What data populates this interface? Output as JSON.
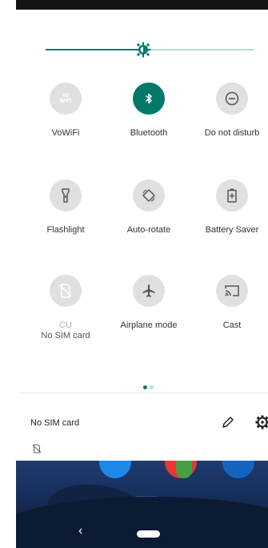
{
  "quick_settings": {
    "brightness_level": 0.47,
    "tiles": [
      {
        "label": "VoWiFi",
        "icon": "vowifi-icon",
        "glyph": "Vo\nWiFi",
        "active": false
      },
      {
        "label": "Bluetooth",
        "icon": "bluetooth-icon",
        "active": true
      },
      {
        "label": "Do not disturb",
        "icon": "do-not-disturb-icon",
        "active": false
      },
      {
        "label": "Flashlight",
        "icon": "flashlight-icon",
        "active": false
      },
      {
        "label": "Auto-rotate",
        "icon": "auto-rotate-icon",
        "active": false
      },
      {
        "label": "Battery Saver",
        "icon": "battery-saver-icon",
        "active": false
      },
      {
        "label": "CU",
        "sublabel": "No SIM card",
        "icon": "no-sim-icon",
        "active": false,
        "disabled": true
      },
      {
        "label": "Airplane mode",
        "icon": "airplane-icon",
        "active": false
      },
      {
        "label": "Cast",
        "icon": "cast-icon",
        "active": false
      }
    ],
    "page_indicator": {
      "pages": 2,
      "current": 1
    },
    "footer": {
      "carrier_text": "No SIM card"
    }
  },
  "colors": {
    "accent": "#00796b",
    "accent_light": "#b2dfdb",
    "tile_inactive": "#e0e0e0"
  },
  "navigation": {
    "back_icon": "back-chevron-icon",
    "home_icon": "home-pill-icon"
  }
}
